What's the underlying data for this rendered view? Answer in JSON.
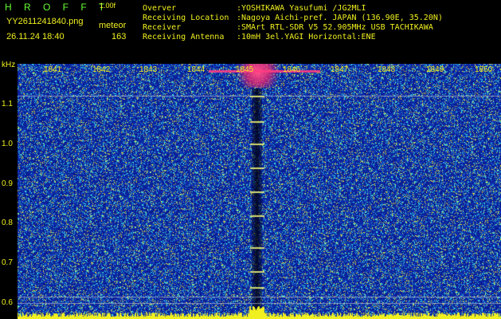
{
  "header": {
    "logo": "H R O F F T",
    "version": "1.00f",
    "filename": "YY2611241840.png",
    "datetime": "26.11.24 18:40",
    "detector_label": "meteor",
    "count": "163"
  },
  "info": [
    {
      "key": "Overver",
      "value": ":YOSHIKAWA Yasufumi /JG2MLI"
    },
    {
      "key": "Receiving Location",
      "value": ":Nagoya Aichi-pref. JAPAN (136.90E, 35.20N)"
    },
    {
      "key": "Receiver",
      "value": ":SMArt RTL-SDR V5 52.905MHz USB TACHIKAWA"
    },
    {
      "key": "Receiving Antenna",
      "value": ":10mH 3el.YAGI Horizontal:ENE"
    }
  ],
  "axis": {
    "y_unit": "kHz",
    "y_ticks": [
      "1.1",
      "1.0",
      "0.9",
      "0.8",
      "0.7",
      "0.6"
    ],
    "time_ticks": [
      "1841",
      "1842",
      "1843",
      "1844",
      "1845",
      "1846",
      "1847",
      "1848",
      "1849",
      "1850"
    ]
  },
  "colors": {
    "background": "#000000",
    "text": "#f0f020",
    "noise_base": "#0a1a8a",
    "signal": "#ff3070"
  }
}
